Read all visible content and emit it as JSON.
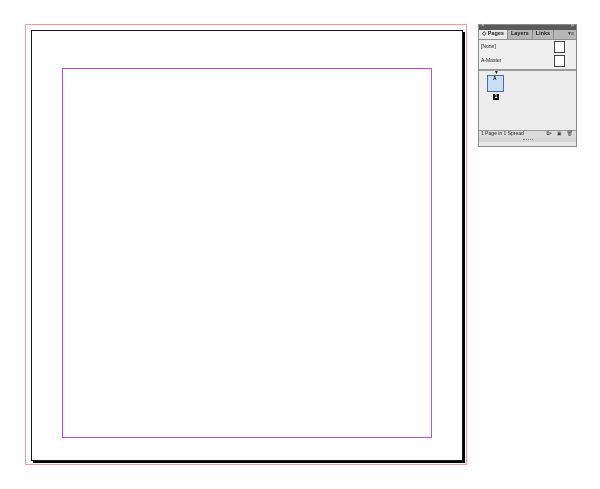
{
  "panel": {
    "tabs": [
      {
        "label": "◇ Pages"
      },
      {
        "label": "Layers"
      },
      {
        "label": "Links"
      }
    ],
    "menu_icon": "panel-menu-icon",
    "masters": [
      {
        "label": "[None]"
      },
      {
        "label": "A-Master"
      }
    ],
    "page_thumb_letter": "A",
    "page_number": "1",
    "status": "1 Page in 1 Spread",
    "status_icons": [
      "page-size-icon",
      "new-page-icon",
      "delete-page-icon"
    ]
  }
}
